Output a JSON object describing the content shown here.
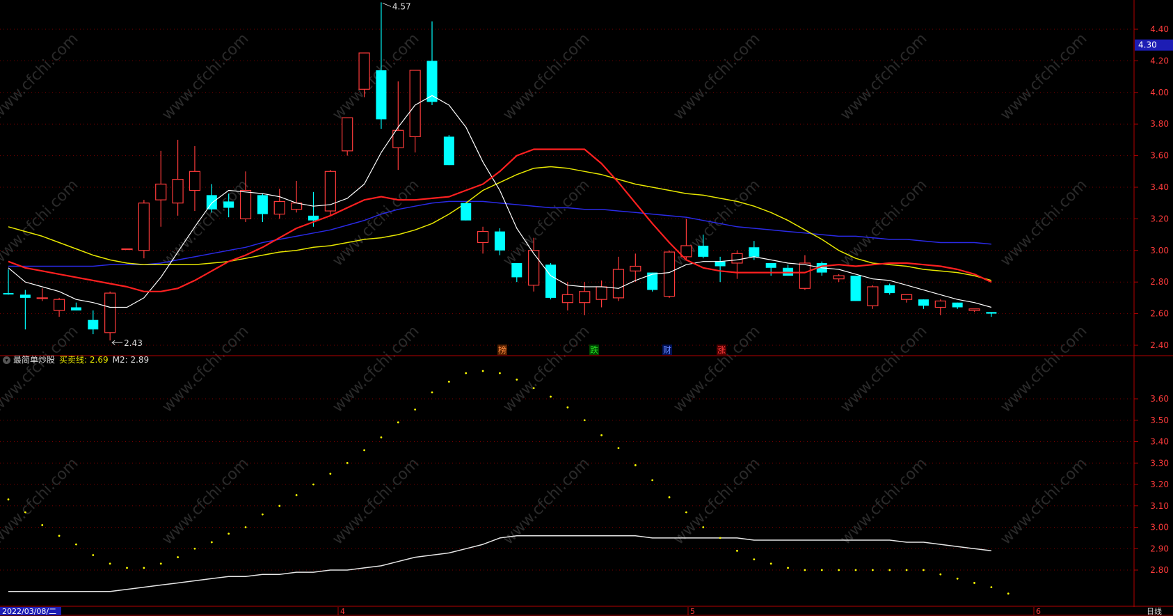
{
  "colors": {
    "background": "#000000",
    "frame": "#b40000",
    "up": "#ff3b3b",
    "down": "#00ffff",
    "ma5": "#ffffff",
    "ma10": "#ff2020",
    "ma20": "#e6e600",
    "ma60": "#2a2ae6",
    "indicator_dots": "#ffff00",
    "indicator_line": "#e6e6e6",
    "grid": "#7a0000",
    "axis_text": "#ff3b3b",
    "watermark": "#2a2a2a"
  },
  "price_axis": {
    "ticks": [
      "4.40",
      "4.20",
      "4.00",
      "3.80",
      "3.60",
      "3.40",
      "3.20",
      "3.00",
      "2.80",
      "2.60",
      "2.40"
    ],
    "current_price": "4.30"
  },
  "indicator_axis": {
    "ticks": [
      "3.60",
      "3.50",
      "3.40",
      "3.30",
      "3.20",
      "3.10",
      "3.00",
      "2.90",
      "2.80"
    ]
  },
  "indicator": {
    "name": "最简单炒股",
    "key1": "买卖线: 2.69",
    "key2": "M2: 2.89"
  },
  "annotations": {
    "high": "4.57",
    "low": "2.43"
  },
  "event_markers": [
    "榜",
    "跌",
    "财",
    "涨"
  ],
  "time_axis": {
    "start_date": "2022/03/08/二",
    "months": [
      "4",
      "5",
      "6"
    ],
    "period": "日线"
  },
  "watermark": "www.cfchi.com",
  "chart_data": {
    "type": "candlestick",
    "candles": [
      {
        "o": 2.73,
        "h": 2.88,
        "l": 2.72,
        "c": 2.85,
        "up": false
      },
      {
        "o": 2.72,
        "h": 2.75,
        "l": 2.5,
        "c": 2.7,
        "up": false
      },
      {
        "o": 2.7,
        "h": 2.76,
        "l": 2.68,
        "c": 2.7,
        "up": true
      },
      {
        "o": 2.62,
        "h": 2.7,
        "l": 2.58,
        "c": 2.69,
        "up": true
      },
      {
        "o": 2.64,
        "h": 2.67,
        "l": 2.62,
        "c": 2.62,
        "up": false
      },
      {
        "o": 2.56,
        "h": 2.62,
        "l": 2.47,
        "c": 2.5,
        "up": false
      },
      {
        "o": 2.48,
        "h": 2.74,
        "l": 2.43,
        "c": 2.73,
        "up": true
      },
      {
        "o": 3.01,
        "h": 3.01,
        "l": 3.01,
        "c": 3.01,
        "up": true
      },
      {
        "o": 3.0,
        "h": 3.32,
        "l": 2.95,
        "c": 3.3,
        "up": true
      },
      {
        "o": 3.32,
        "h": 3.63,
        "l": 3.15,
        "c": 3.42,
        "up": true
      },
      {
        "o": 3.3,
        "h": 3.7,
        "l": 3.22,
        "c": 3.45,
        "up": true
      },
      {
        "o": 3.38,
        "h": 3.66,
        "l": 3.25,
        "c": 3.5,
        "up": true
      },
      {
        "o": 3.35,
        "h": 3.42,
        "l": 3.24,
        "c": 3.26,
        "up": false
      },
      {
        "o": 3.31,
        "h": 3.36,
        "l": 3.21,
        "c": 3.27,
        "up": false
      },
      {
        "o": 3.2,
        "h": 3.5,
        "l": 3.18,
        "c": 3.38,
        "up": true
      },
      {
        "o": 3.35,
        "h": 3.36,
        "l": 3.18,
        "c": 3.23,
        "up": false
      },
      {
        "o": 3.23,
        "h": 3.39,
        "l": 3.2,
        "c": 3.31,
        "up": true
      },
      {
        "o": 3.26,
        "h": 3.44,
        "l": 3.24,
        "c": 3.3,
        "up": true
      },
      {
        "o": 3.22,
        "h": 3.37,
        "l": 3.15,
        "c": 3.19,
        "up": false
      },
      {
        "o": 3.25,
        "h": 3.51,
        "l": 3.22,
        "c": 3.5,
        "up": true
      },
      {
        "o": 3.63,
        "h": 3.84,
        "l": 3.6,
        "c": 3.84,
        "up": true
      },
      {
        "o": 4.02,
        "h": 4.25,
        "l": 3.97,
        "c": 4.25,
        "up": true
      },
      {
        "o": 4.14,
        "h": 4.57,
        "l": 3.77,
        "c": 3.83,
        "up": false
      },
      {
        "o": 3.65,
        "h": 4.07,
        "l": 3.51,
        "c": 3.76,
        "up": true
      },
      {
        "o": 3.72,
        "h": 4.14,
        "l": 3.62,
        "c": 4.14,
        "up": true
      },
      {
        "o": 4.2,
        "h": 4.45,
        "l": 3.92,
        "c": 3.94,
        "up": false
      },
      {
        "o": 3.72,
        "h": 3.73,
        "l": 3.54,
        "c": 3.54,
        "up": false
      },
      {
        "o": 3.3,
        "h": 3.3,
        "l": 3.19,
        "c": 3.19,
        "up": false
      },
      {
        "o": 3.05,
        "h": 3.15,
        "l": 2.98,
        "c": 3.12,
        "up": true
      },
      {
        "o": 3.12,
        "h": 3.14,
        "l": 2.97,
        "c": 3.0,
        "up": false
      },
      {
        "o": 2.92,
        "h": 2.92,
        "l": 2.8,
        "c": 2.83,
        "up": false
      },
      {
        "o": 2.78,
        "h": 3.08,
        "l": 2.74,
        "c": 3.0,
        "up": true
      },
      {
        "o": 2.91,
        "h": 2.92,
        "l": 2.69,
        "c": 2.7,
        "up": false
      },
      {
        "o": 2.67,
        "h": 2.8,
        "l": 2.62,
        "c": 2.72,
        "up": true
      },
      {
        "o": 2.67,
        "h": 2.8,
        "l": 2.59,
        "c": 2.74,
        "up": true
      },
      {
        "o": 2.69,
        "h": 2.81,
        "l": 2.64,
        "c": 2.77,
        "up": true
      },
      {
        "o": 2.7,
        "h": 2.96,
        "l": 2.68,
        "c": 2.88,
        "up": true
      },
      {
        "o": 2.87,
        "h": 2.98,
        "l": 2.8,
        "c": 2.9,
        "up": true
      },
      {
        "o": 2.86,
        "h": 2.86,
        "l": 2.74,
        "c": 2.75,
        "up": false
      },
      {
        "o": 2.71,
        "h": 3.0,
        "l": 2.7,
        "c": 2.99,
        "up": true
      },
      {
        "o": 2.96,
        "h": 3.2,
        "l": 2.94,
        "c": 3.03,
        "up": true
      },
      {
        "o": 3.03,
        "h": 3.1,
        "l": 2.95,
        "c": 2.96,
        "up": false
      },
      {
        "o": 2.93,
        "h": 2.96,
        "l": 2.8,
        "c": 2.9,
        "up": false
      },
      {
        "o": 2.92,
        "h": 3.0,
        "l": 2.82,
        "c": 2.98,
        "up": true
      },
      {
        "o": 3.02,
        "h": 3.06,
        "l": 2.94,
        "c": 2.96,
        "up": false
      },
      {
        "o": 2.92,
        "h": 2.92,
        "l": 2.84,
        "c": 2.89,
        "up": false
      },
      {
        "o": 2.89,
        "h": 2.91,
        "l": 2.84,
        "c": 2.84,
        "up": false
      },
      {
        "o": 2.76,
        "h": 2.97,
        "l": 2.75,
        "c": 2.92,
        "up": true
      },
      {
        "o": 2.92,
        "h": 2.93,
        "l": 2.84,
        "c": 2.86,
        "up": false
      },
      {
        "o": 2.82,
        "h": 2.85,
        "l": 2.8,
        "c": 2.84,
        "up": true
      },
      {
        "o": 2.84,
        "h": 2.84,
        "l": 2.68,
        "c": 2.68,
        "up": false
      },
      {
        "o": 2.65,
        "h": 2.78,
        "l": 2.63,
        "c": 2.77,
        "up": true
      },
      {
        "o": 2.78,
        "h": 2.79,
        "l": 2.72,
        "c": 2.73,
        "up": false
      },
      {
        "o": 2.69,
        "h": 2.72,
        "l": 2.67,
        "c": 2.72,
        "up": true
      },
      {
        "o": 2.69,
        "h": 2.69,
        "l": 2.63,
        "c": 2.65,
        "up": false
      },
      {
        "o": 2.64,
        "h": 2.69,
        "l": 2.59,
        "c": 2.68,
        "up": true
      },
      {
        "o": 2.67,
        "h": 2.67,
        "l": 2.63,
        "c": 2.64,
        "up": false
      },
      {
        "o": 2.62,
        "h": 2.63,
        "l": 2.61,
        "c": 2.63,
        "up": true
      },
      {
        "o": 2.61,
        "h": 2.61,
        "l": 2.58,
        "c": 2.6,
        "up": false
      }
    ],
    "ma5": [
      2.89,
      2.8,
      2.77,
      2.74,
      2.69,
      2.67,
      2.64,
      2.64,
      2.7,
      2.83,
      2.99,
      3.15,
      3.3,
      3.38,
      3.37,
      3.36,
      3.34,
      3.3,
      3.28,
      3.29,
      3.33,
      3.42,
      3.62,
      3.78,
      3.92,
      3.98,
      3.92,
      3.78,
      3.56,
      3.38,
      3.14,
      2.98,
      2.84,
      2.78,
      2.77,
      2.77,
      2.76,
      2.81,
      2.85,
      2.86,
      2.91,
      2.93,
      2.93,
      2.94,
      2.96,
      2.94,
      2.92,
      2.91,
      2.89,
      2.88,
      2.85,
      2.82,
      2.81,
      2.78,
      2.75,
      2.72,
      2.69,
      2.67,
      2.64
    ],
    "ma10": [
      2.93,
      2.89,
      2.87,
      2.85,
      2.83,
      2.81,
      2.79,
      2.77,
      2.74,
      2.74,
      2.76,
      2.81,
      2.87,
      2.93,
      2.97,
      3.02,
      3.08,
      3.14,
      3.18,
      3.22,
      3.27,
      3.32,
      3.34,
      3.32,
      3.32,
      3.33,
      3.34,
      3.38,
      3.42,
      3.5,
      3.6,
      3.64,
      3.64,
      3.64,
      3.64,
      3.55,
      3.43,
      3.3,
      3.17,
      3.05,
      2.94,
      2.89,
      2.87,
      2.86,
      2.86,
      2.86,
      2.86,
      2.86,
      2.9,
      2.91,
      2.9,
      2.91,
      2.92,
      2.92,
      2.91,
      2.9,
      2.88,
      2.85,
      2.8
    ],
    "ma20": [
      3.15,
      3.12,
      3.09,
      3.05,
      3.01,
      2.97,
      2.94,
      2.92,
      2.91,
      2.91,
      2.91,
      2.91,
      2.92,
      2.93,
      2.95,
      2.97,
      2.99,
      3.0,
      3.02,
      3.03,
      3.05,
      3.07,
      3.08,
      3.1,
      3.13,
      3.17,
      3.23,
      3.3,
      3.38,
      3.43,
      3.48,
      3.52,
      3.53,
      3.52,
      3.5,
      3.48,
      3.45,
      3.42,
      3.4,
      3.38,
      3.36,
      3.35,
      3.33,
      3.31,
      3.28,
      3.24,
      3.19,
      3.13,
      3.07,
      3.0,
      2.95,
      2.92,
      2.91,
      2.9,
      2.88,
      2.87,
      2.86,
      2.84,
      2.81
    ],
    "ma60": [
      2.9,
      2.9,
      2.9,
      2.9,
      2.9,
      2.9,
      2.91,
      2.91,
      2.91,
      2.92,
      2.94,
      2.96,
      2.98,
      3.0,
      3.02,
      3.05,
      3.07,
      3.09,
      3.11,
      3.13,
      3.16,
      3.19,
      3.23,
      3.26,
      3.28,
      3.3,
      3.31,
      3.31,
      3.31,
      3.3,
      3.29,
      3.28,
      3.27,
      3.27,
      3.26,
      3.26,
      3.25,
      3.24,
      3.23,
      3.22,
      3.21,
      3.19,
      3.17,
      3.15,
      3.14,
      3.13,
      3.12,
      3.11,
      3.1,
      3.09,
      3.09,
      3.08,
      3.07,
      3.07,
      3.06,
      3.05,
      3.05,
      3.05,
      3.04
    ],
    "indicator_dots": [
      3.13,
      3.07,
      3.01,
      2.96,
      2.92,
      2.87,
      2.83,
      2.81,
      2.81,
      2.83,
      2.86,
      2.9,
      2.93,
      2.97,
      3.0,
      3.06,
      3.1,
      3.15,
      3.2,
      3.25,
      3.3,
      3.36,
      3.42,
      3.49,
      3.55,
      3.63,
      3.68,
      3.72,
      3.73,
      3.72,
      3.69,
      3.65,
      3.61,
      3.56,
      3.5,
      3.43,
      3.37,
      3.29,
      3.22,
      3.14,
      3.07,
      3.0,
      2.95,
      2.89,
      2.85,
      2.83,
      2.81,
      2.8,
      2.8,
      2.8,
      2.8,
      2.8,
      2.8,
      2.8,
      2.8,
      2.78,
      2.76,
      2.74,
      2.72,
      2.69
    ],
    "indicator_line": [
      2.7,
      2.7,
      2.7,
      2.7,
      2.7,
      2.7,
      2.7,
      2.71,
      2.72,
      2.73,
      2.74,
      2.75,
      2.76,
      2.77,
      2.77,
      2.78,
      2.78,
      2.79,
      2.79,
      2.8,
      2.8,
      2.81,
      2.82,
      2.84,
      2.86,
      2.87,
      2.88,
      2.9,
      2.92,
      2.95,
      2.96,
      2.96,
      2.96,
      2.96,
      2.96,
      2.96,
      2.96,
      2.96,
      2.95,
      2.95,
      2.95,
      2.95,
      2.95,
      2.95,
      2.94,
      2.94,
      2.94,
      2.94,
      2.94,
      2.94,
      2.94,
      2.94,
      2.94,
      2.93,
      2.93,
      2.92,
      2.91,
      2.9,
      2.89
    ],
    "price_range": [
      2.36,
      4.57
    ],
    "indicator_range": [
      2.66,
      3.75
    ]
  }
}
